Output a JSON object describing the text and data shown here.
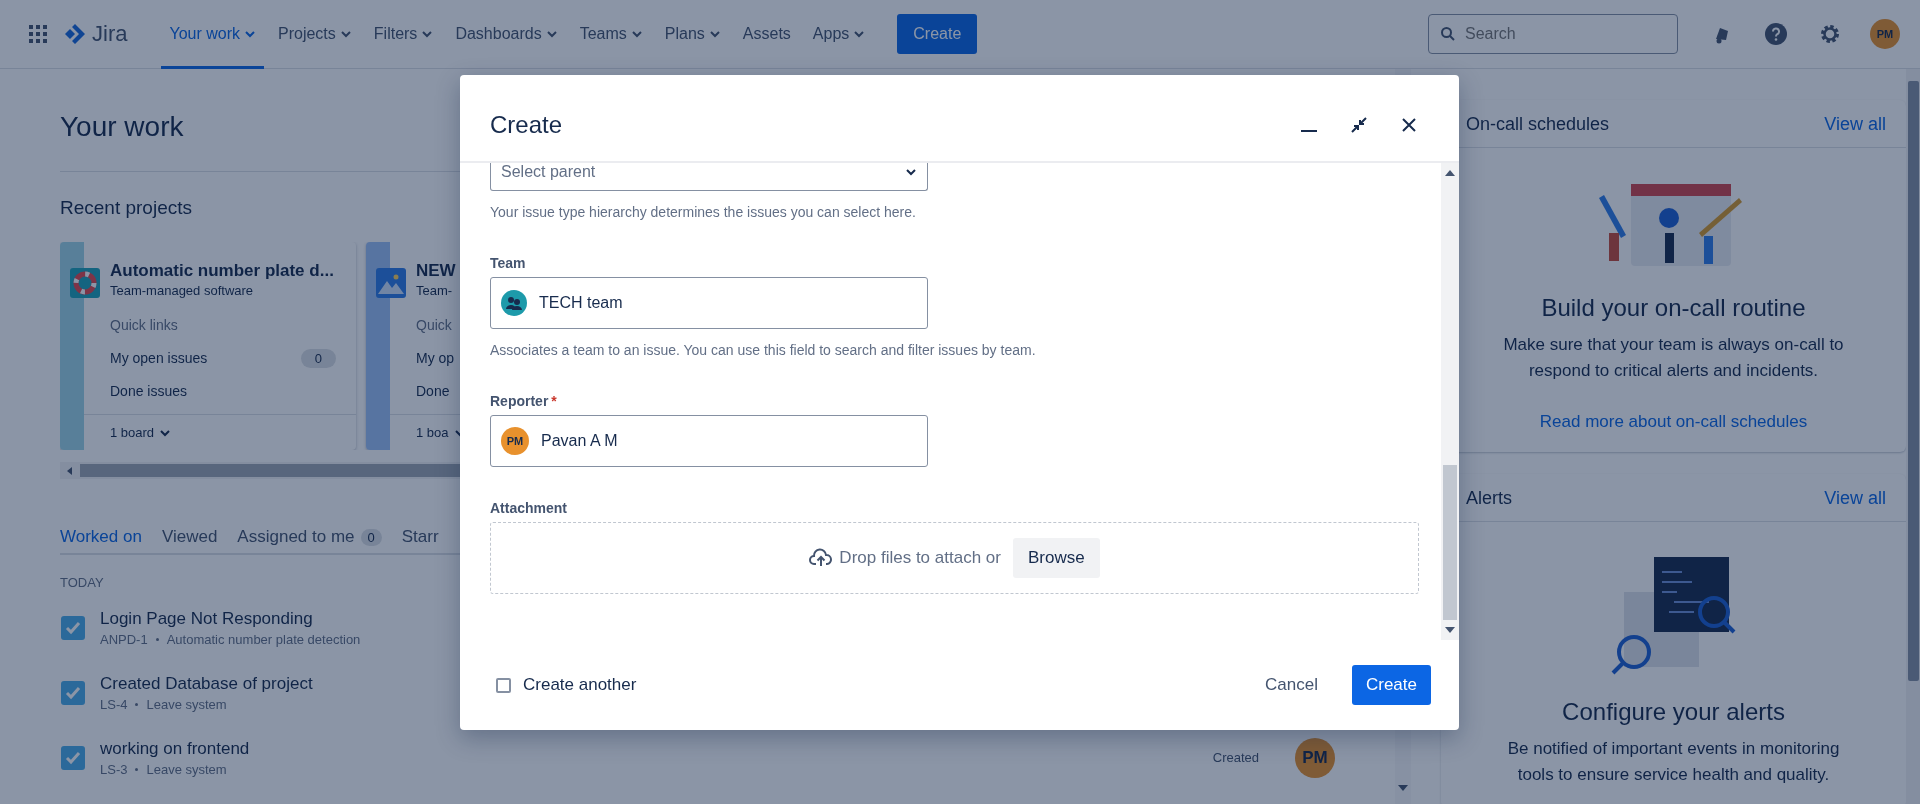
{
  "nav": {
    "product": "Jira",
    "items": [
      {
        "label": "Your work",
        "selected": true,
        "has_menu": true
      },
      {
        "label": "Projects",
        "selected": false,
        "has_menu": true
      },
      {
        "label": "Filters",
        "selected": false,
        "has_menu": true
      },
      {
        "label": "Dashboards",
        "selected": false,
        "has_menu": true
      },
      {
        "label": "Teams",
        "selected": false,
        "has_menu": true
      },
      {
        "label": "Plans",
        "selected": false,
        "has_menu": true
      },
      {
        "label": "Assets",
        "selected": false,
        "has_menu": false
      },
      {
        "label": "Apps",
        "selected": false,
        "has_menu": true
      }
    ],
    "create_button": "Create",
    "search": {
      "placeholder": "Search"
    },
    "avatar": "PM"
  },
  "main": {
    "title": "Your work",
    "recent_projects": {
      "heading": "Recent projects",
      "projects": [
        {
          "name": "Automatic number plate d...",
          "type": "Team-managed software",
          "quick_links": "Quick links",
          "links": [
            {
              "label": "My open issues",
              "count": "0"
            },
            {
              "label": "Done issues"
            }
          ],
          "boards": "1 board"
        },
        {
          "name": "NEW",
          "type": "Team-",
          "quick_links": "Quick",
          "links": [
            {
              "label": "My op"
            },
            {
              "label": "Done"
            }
          ],
          "boards": "1 boa"
        }
      ]
    },
    "tabs": [
      {
        "label": "Worked on",
        "selected": true
      },
      {
        "label": "Viewed",
        "selected": false
      },
      {
        "label": "Assigned to me",
        "selected": false,
        "count": "0"
      },
      {
        "label": "Starr",
        "selected": false
      }
    ],
    "section": "TODAY",
    "issues": [
      {
        "title": "Login Page Not Responding",
        "key": "ANPD-1",
        "project": "Automatic number plate detection"
      },
      {
        "title": "Created Database of project",
        "key": "LS-4",
        "project": "Leave system"
      },
      {
        "title": "working on frontend",
        "key": "LS-3",
        "project": "Leave system",
        "activity": "Created",
        "avatar": "PM"
      }
    ]
  },
  "side": [
    {
      "title": "On-call schedules",
      "action": "View all",
      "headline": "Build your on-call routine",
      "text": "Make sure that your team is always on-call to respond to critical alerts and incidents.",
      "link": "Read more about on-call schedules"
    },
    {
      "title": "Alerts",
      "action": "View all",
      "headline": "Configure your alerts",
      "text": "Be notified of important events in monitoring tools to ensure service health and quality."
    }
  ],
  "dialog": {
    "title": "Create",
    "fields": [
      {
        "kind": "select",
        "placeholder": "Select parent",
        "help": "Your issue type hierarchy determines the issues you can select here."
      },
      {
        "kind": "team",
        "label": "Team",
        "value": "TECH team",
        "help": "Associates a team to an issue. You can use this field to search and filter issues by team."
      },
      {
        "kind": "user",
        "label": "Reporter",
        "required_mark": "*",
        "value": "Pavan A M",
        "avatar": "PM"
      },
      {
        "kind": "attachment",
        "label": "Attachment",
        "text": "Drop files to attach or",
        "button": "Browse"
      }
    ],
    "create_another": {
      "label": "Create another",
      "checked": false
    },
    "cancel": "Cancel",
    "submit": "Create"
  }
}
